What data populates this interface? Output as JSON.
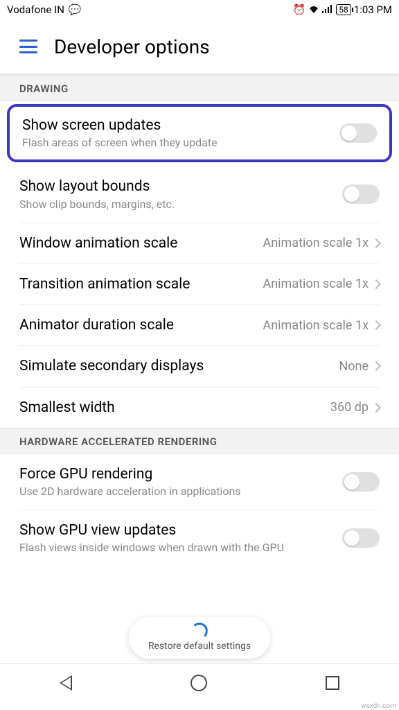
{
  "status": {
    "carrier": "Vodafone IN",
    "battery": "58",
    "time": "1:03 PM"
  },
  "header": {
    "title": "Developer options"
  },
  "sections": {
    "drawing": {
      "label": "DRAWING",
      "items": {
        "show_screen_updates": {
          "title": "Show screen updates",
          "sub": "Flash areas of screen when they update"
        },
        "show_layout_bounds": {
          "title": "Show layout bounds",
          "sub": "Show clip bounds, margins, etc."
        },
        "window_anim": {
          "title": "Window animation scale",
          "value": "Animation scale 1x"
        },
        "transition_anim": {
          "title": "Transition animation scale",
          "value": "Animation scale 1x"
        },
        "animator_duration": {
          "title": "Animator duration scale",
          "value": "Animation scale 1x"
        },
        "simulate_secondary": {
          "title": "Simulate secondary displays",
          "value": "None"
        },
        "smallest_width": {
          "title": "Smallest width",
          "value": "360 dp"
        }
      }
    },
    "hw_render": {
      "label": "HARDWARE ACCELERATED RENDERING",
      "items": {
        "force_gpu": {
          "title": "Force GPU rendering",
          "sub": "Use 2D hardware acceleration in applications"
        },
        "gpu_view_updates": {
          "title": "Show GPU view updates",
          "sub": "Flash views inside windows when drawn with the GPU"
        }
      }
    }
  },
  "restore": {
    "label": "Restore default settings"
  },
  "watermark": "wsxdn.com"
}
